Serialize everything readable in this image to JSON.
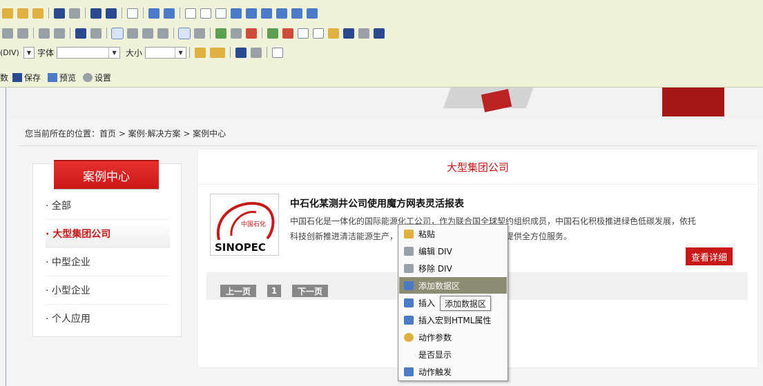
{
  "toolbar": {
    "row3": {
      "format_value": "(DIV)",
      "font_label": "字体",
      "font_value": "",
      "size_label": "大小",
      "size_value": ""
    },
    "row4": {
      "truncated_label": "数",
      "save_label": "保存",
      "preview_label": "预览",
      "settings_label": "设置"
    }
  },
  "breadcrumb": "您当前所在的位置：首页 > 案例·解决方案 > 案例中心",
  "sidebar": {
    "title": "案例中心",
    "items": [
      {
        "label": "· 全部"
      },
      {
        "label": "· 大型集团公司"
      },
      {
        "label": "· 中型企业"
      },
      {
        "label": "· 小型企业"
      },
      {
        "label": "· 个人应用"
      }
    ]
  },
  "main": {
    "category_title": "大型集团公司",
    "case": {
      "logo_text": "SINOPEC",
      "logo_cn": "中国石化",
      "title": "中石化某测井公司使用魔方网表灵活报表",
      "desc_line1": "中国石化是一体化的国际能源化工公司，作为联合国全球契约组织成员，中国石化积极推进绿色低碳发展，依托",
      "desc_line2": "科技创新推进清洁能源生产，为社会发展和人们的衣食住行提供全方位服务。",
      "detail_label": "查看详细"
    },
    "pager": {
      "prev": "上一页",
      "page": "1",
      "next": "下一页"
    }
  },
  "context_menu": {
    "items": [
      {
        "label": "粘贴"
      },
      {
        "label": "编辑 DIV"
      },
      {
        "label": "移除 DIV"
      },
      {
        "label": "添加数据区"
      },
      {
        "label": "插入"
      },
      {
        "label": "插入宏到HTML属性"
      },
      {
        "label": "动作参数"
      },
      {
        "label": "是否显示"
      },
      {
        "label": "动作触发"
      }
    ],
    "tooltip": "添加数据区"
  }
}
